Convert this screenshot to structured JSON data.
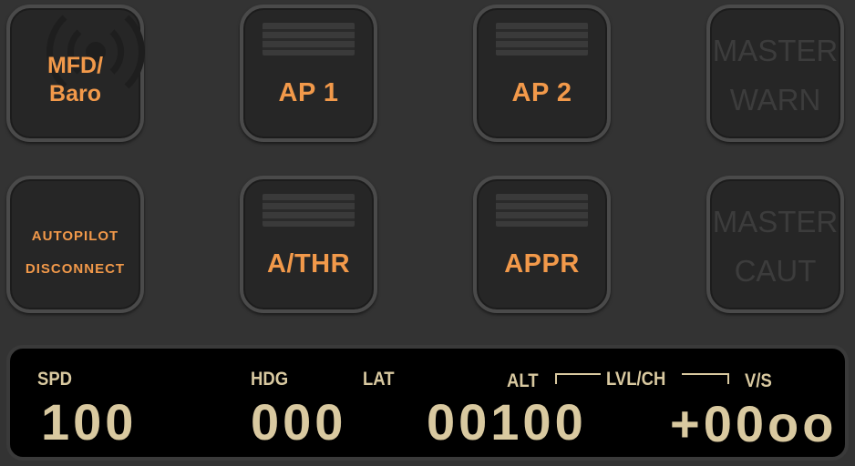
{
  "buttons": {
    "mfd_baro": {
      "line1": "MFD/",
      "line2": "Baro"
    },
    "ap1": {
      "label": "AP 1"
    },
    "ap2": {
      "label": "AP 2"
    },
    "master_warn": {
      "line1": "MASTER",
      "line2": "WARN"
    },
    "autopilot_disconnect": {
      "line1": "AUTOPILOT",
      "line2": "DISCONNECT"
    },
    "athr": {
      "label": "A/THR"
    },
    "appr": {
      "label": "APPR"
    },
    "master_caut": {
      "line1": "MASTER",
      "line2": "CAUT"
    }
  },
  "display": {
    "spd_label": "SPD",
    "spd_value": "100",
    "hdg_label": "HDG",
    "lat_label": "LAT",
    "hdg_value": "000",
    "alt_label": "ALT",
    "lvlch_label": "LVL/CH",
    "alt_value": "00100",
    "vs_label": "V/S",
    "vs_value": "+00oo"
  },
  "colors": {
    "label_active": "#f2994a",
    "label_inactive": "#3c3c3c",
    "display_text": "#d9c9a0",
    "panel_bg": "#333333"
  }
}
